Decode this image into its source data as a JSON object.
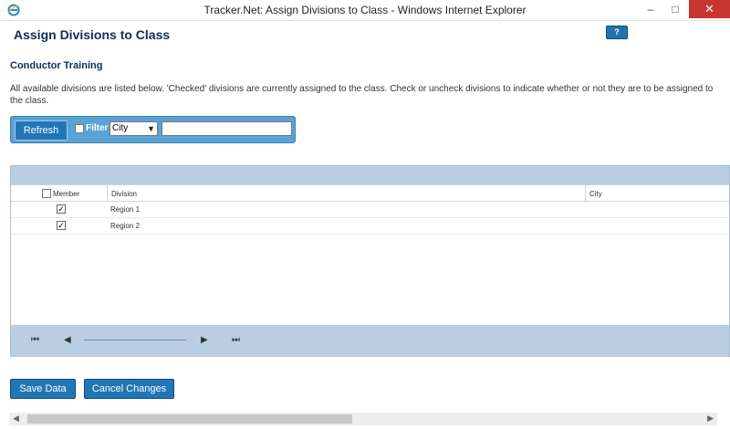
{
  "window": {
    "title": "Tracker.Net: Assign Divisions to Class - Windows Internet Explorer",
    "minimize": "–",
    "maximize": "□",
    "close": "✕"
  },
  "page": {
    "title": "Assign Divisions to Class",
    "help_label": "?",
    "class_name": "Conductor Training",
    "description": "All available divisions are listed below. 'Checked' divisions are currently assigned to the class. Check or uncheck divisions to indicate whether or not they are to be assigned to the class."
  },
  "toolbar": {
    "refresh_label": "Refresh",
    "filter_label": "Filter",
    "filter_checked": false,
    "filter_field_selected": "City",
    "filter_value": ""
  },
  "grid": {
    "columns": [
      "Member",
      "Division",
      "City"
    ],
    "rows": [
      {
        "member": true,
        "division": "Region 1",
        "city": ""
      },
      {
        "member": true,
        "division": "Region 2",
        "city": ""
      }
    ],
    "pager": {
      "first": "⏮",
      "prev": "◀",
      "next": "▶",
      "last": "⏭"
    }
  },
  "actions": {
    "save_label": "Save Data",
    "cancel_label": "Cancel Changes"
  },
  "colors": {
    "accent": "#2276b5",
    "panel": "#59a3d4",
    "grid_band": "#b9cde3",
    "close": "#c7372f"
  },
  "icons": [
    "ie-logo-icon",
    "help-icon",
    "first-page-icon",
    "prev-page-icon",
    "next-page-icon",
    "last-page-icon",
    "check-icon"
  ]
}
